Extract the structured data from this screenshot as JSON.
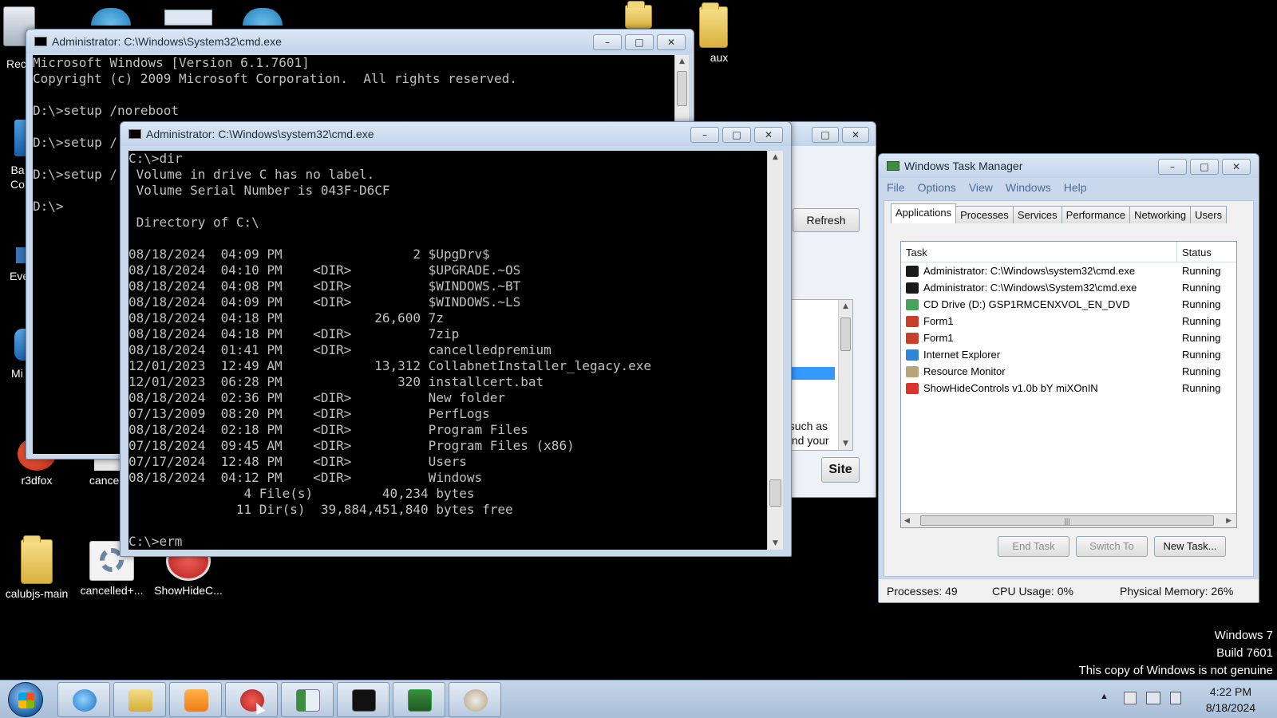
{
  "desktop": {
    "icons": [
      {
        "label": "Rec"
      },
      {
        "label": "Ba Co"
      },
      {
        "label": "Eve"
      },
      {
        "label": "Mi"
      },
      {
        "label": "aux"
      },
      {
        "label": "r3dfox"
      },
      {
        "label": "cancelfa"
      },
      {
        "label": "calubjs-main"
      },
      {
        "label": "cancelled+..."
      },
      {
        "label": "ShowHideC..."
      }
    ],
    "watermark": {
      "line1": "Windows 7",
      "line2": "Build 7601",
      "line3": "This copy of Windows is not genuine"
    }
  },
  "cmd_back": {
    "title": "Administrator: C:\\Windows\\System32\\cmd.exe",
    "lines": [
      "Microsoft Windows [Version 6.1.7601]",
      "Copyright (c) 2009 Microsoft Corporation.  All rights reserved.",
      "",
      "D:\\>setup /noreboot",
      "",
      "D:\\>setup /",
      "",
      "D:\\>setup /",
      "",
      "D:\\>"
    ]
  },
  "middle_window": {
    "refresh_label": "Refresh",
    "text_line1": "s, such as",
    "text_line2": "il and your",
    "site_label": "Site"
  },
  "cmd_front": {
    "title": "Administrator: C:\\Windows\\system32\\cmd.exe",
    "lines": [
      "C:\\>dir",
      " Volume in drive C has no label.",
      " Volume Serial Number is 043F-D6CF",
      "",
      " Directory of C:\\",
      "",
      "08/18/2024  04:09 PM                 2 $UpgDrv$",
      "08/18/2024  04:10 PM    <DIR>          $UPGRADE.~OS",
      "08/18/2024  04:08 PM    <DIR>          $WINDOWS.~BT",
      "08/18/2024  04:09 PM    <DIR>          $WINDOWS.~LS",
      "08/18/2024  04:18 PM            26,600 7z",
      "08/18/2024  04:18 PM    <DIR>          7zip",
      "08/18/2024  01:41 PM    <DIR>          cancelledpremium",
      "12/01/2023  12:49 AM            13,312 CollabnetInstaller_legacy.exe",
      "12/01/2023  06:28 PM               320 installcert.bat",
      "08/18/2024  02:36 PM    <DIR>          New folder",
      "07/13/2009  08:20 PM    <DIR>          PerfLogs",
      "08/18/2024  02:18 PM    <DIR>          Program Files",
      "07/18/2024  09:45 AM    <DIR>          Program Files (x86)",
      "07/17/2024  12:48 PM    <DIR>          Users",
      "08/18/2024  04:12 PM    <DIR>          Windows",
      "               4 File(s)         40,234 bytes",
      "              11 Dir(s)  39,884,451,840 bytes free",
      "",
      "C:\\>erm"
    ]
  },
  "task_manager": {
    "title": "Windows Task Manager",
    "menu": [
      "File",
      "Options",
      "View",
      "Windows",
      "Help"
    ],
    "tabs": [
      "Applications",
      "Processes",
      "Services",
      "Performance",
      "Networking",
      "Users"
    ],
    "active_tab": "Applications",
    "columns": {
      "task": "Task",
      "status": "Status"
    },
    "rows": [
      {
        "task": "Administrator: C:\\Windows\\system32\\cmd.exe",
        "status": "Running",
        "icon": "cmd-icon",
        "color": "#1a1a1a"
      },
      {
        "task": "Administrator: C:\\Windows\\System32\\cmd.exe",
        "status": "Running",
        "icon": "cmd-icon",
        "color": "#1a1a1a"
      },
      {
        "task": "CD Drive (D:) GSP1RMCENXVOL_EN_DVD",
        "status": "Running",
        "icon": "cd-drive-icon",
        "color": "#4aa35a"
      },
      {
        "task": "Form1",
        "status": "Running",
        "icon": "form-icon",
        "color": "#c8402a"
      },
      {
        "task": "Form1",
        "status": "Running",
        "icon": "form-icon",
        "color": "#c8402a"
      },
      {
        "task": "Internet Explorer",
        "status": "Running",
        "icon": "internet-explorer-icon",
        "color": "#2f86d6"
      },
      {
        "task": "Resource Monitor",
        "status": "Running",
        "icon": "resource-monitor-icon",
        "color": "#b9a37a"
      },
      {
        "task": "ShowHideControls v1.0b bY miXOnIN",
        "status": "Running",
        "icon": "showhide-icon",
        "color": "#d9332b"
      }
    ],
    "buttons": {
      "end_task": "End Task",
      "switch_to": "Switch To",
      "new_task": "New Task..."
    },
    "status": {
      "processes": "Processes: 49",
      "cpu": "CPU Usage: 0%",
      "memory": "Physical Memory: 26%"
    }
  },
  "taskbar": {
    "items": [
      {
        "name": "start-button"
      },
      {
        "name": "internet-explorer-icon"
      },
      {
        "name": "file-explorer-icon"
      },
      {
        "name": "media-player-icon"
      },
      {
        "name": "showhide-taskbar-icon"
      },
      {
        "name": "window-app-icon"
      },
      {
        "name": "cmd-taskbar-icon"
      },
      {
        "name": "task-manager-taskbar-icon"
      },
      {
        "name": "resource-monitor-taskbar-icon"
      }
    ],
    "clock_time": "4:22 PM",
    "clock_date": "8/18/2024"
  }
}
